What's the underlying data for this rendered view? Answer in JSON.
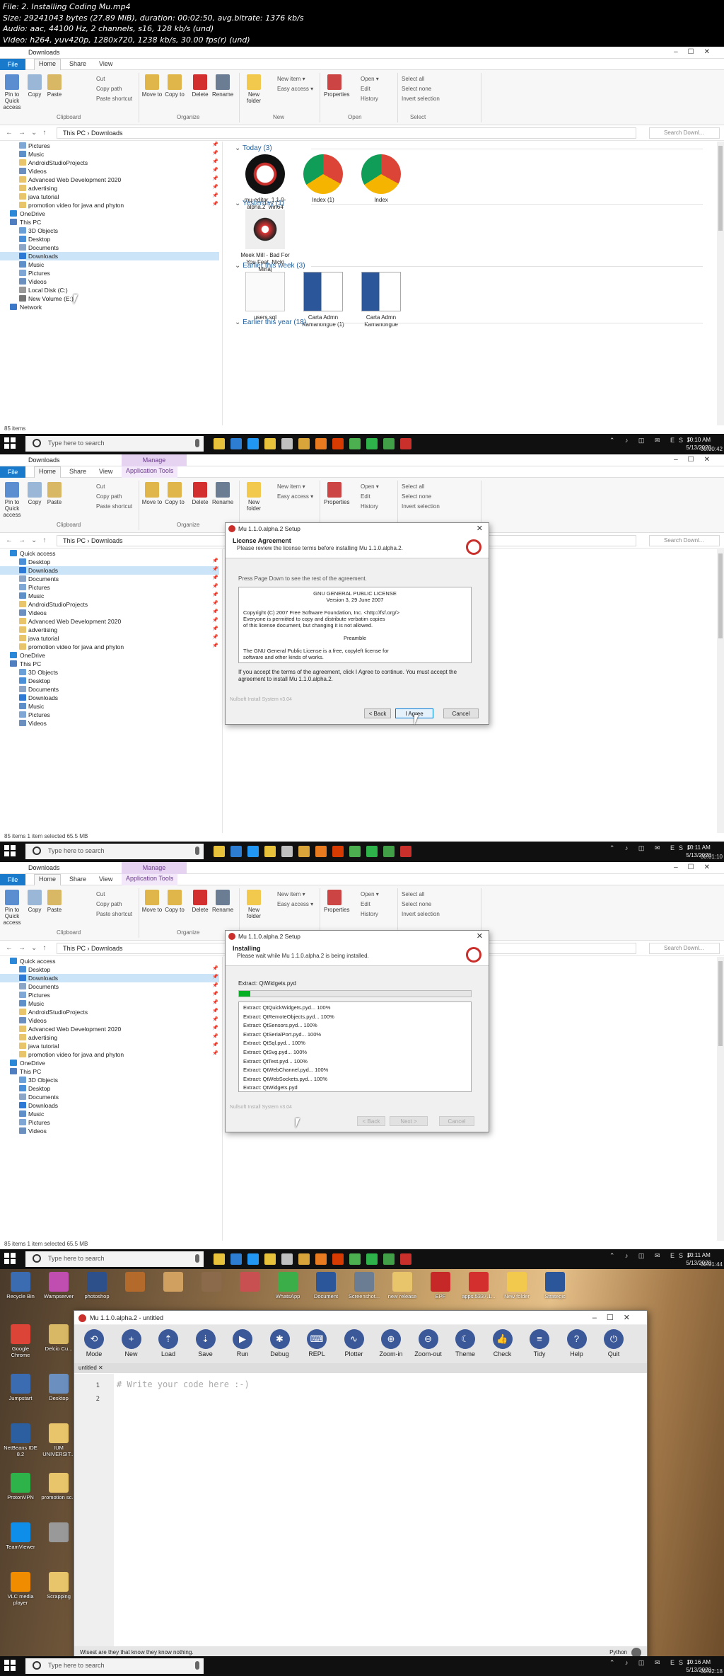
{
  "meta": {
    "line1": "File: 2. Installing Coding Mu.mp4",
    "line2": "Size: 29241043 bytes (27.89 MiB), duration: 00:02:50, avg.bitrate: 1376 kb/s",
    "line3": "Audio: aac, 44100 Hz, 2 channels, s16, 128 kb/s (und)",
    "line4": "Video: h264, yuv420p, 1280x720, 1238 kb/s, 30.00 fps(r) (und)"
  },
  "explorer": {
    "title": "Downloads",
    "manage": "Manage",
    "tabs": {
      "file": "File",
      "home": "Home",
      "share": "Share",
      "view": "View",
      "app_tools": "Application Tools"
    },
    "ribbon": {
      "pin": "Pin to Quick access",
      "copy": "Copy",
      "paste": "Paste",
      "cut": "Cut",
      "copy_path": "Copy path",
      "paste_shortcut": "Paste shortcut",
      "move_to": "Move to",
      "copy_to": "Copy to",
      "delete": "Delete",
      "rename": "Rename",
      "new_folder": "New folder",
      "new_item": "New item ▾",
      "easy_access": "Easy access ▾",
      "properties": "Properties",
      "open": "Open ▾",
      "edit": "Edit",
      "history": "History",
      "select_all": "Select all",
      "select_none": "Select none",
      "invert": "Invert selection",
      "g_clipboard": "Clipboard",
      "g_organize": "Organize",
      "g_new": "New",
      "g_open": "Open",
      "g_select": "Select"
    },
    "path": "This PC  ›  Downloads",
    "search": "Search Downl...",
    "nav1": [
      "Pictures",
      "Music",
      "AndroidStudioProjects",
      "Videos",
      "Advanced Web Development 2020",
      "advertising",
      "java tutorial",
      "promotion video for java and phyton",
      "OneDrive",
      "This PC",
      "3D Objects",
      "Desktop",
      "Documents",
      "Downloads",
      "Music",
      "Pictures",
      "Videos",
      "Local Disk (C:)",
      "New Volume (E:)",
      "Network"
    ],
    "nav2": [
      "Quick access",
      "Desktop",
      "Downloads",
      "Documents",
      "Pictures",
      "Music",
      "AndroidStudioProjects",
      "Videos",
      "Advanced Web Development 2020",
      "advertising",
      "java tutorial",
      "promotion video for java and phyton",
      "OneDrive",
      "This PC",
      "3D Objects",
      "Desktop",
      "Documents",
      "Downloads",
      "Music",
      "Pictures",
      "Videos"
    ],
    "groups": {
      "today": "Today (3)",
      "yesterday": "Yesterday (1)",
      "earlier_week": "Earlier this week (3)",
      "earlier_year": "Earlier this year (18)"
    },
    "files_today": [
      "mu-editor_1.1.0-alpha.2_win64",
      "Index (1)",
      "Index"
    ],
    "files_yesterday": [
      "Meek Mill - Bad For You Feat. Nicki Minaj"
    ],
    "files_week": [
      "users.sql",
      "Carta Admn Kamanongue (1)",
      "Carta Admn Kamanongue"
    ],
    "status1": "85 items",
    "status2": "85 items    1 item selected  65.5 MB"
  },
  "taskbar": {
    "search": "Type here to search",
    "lang": "ESP",
    "clock1": {
      "time": "10:10 AM",
      "date": "5/13/2020"
    },
    "clock2": {
      "time": "10:11 AM",
      "date": "5/13/2020"
    },
    "clock3": {
      "time": "10:11 AM",
      "date": "5/13/2020"
    },
    "clock4": {
      "time": "10:16 AM",
      "date": "5/13/2020"
    },
    "stamps": [
      "00:00:42",
      "00:01:10",
      "00:01:44",
      "00:02:18"
    ]
  },
  "license_dialog": {
    "title": "Mu 1.1.0.alpha.2 Setup",
    "heading": "License Agreement",
    "sub": "Please review the license terms before installing Mu 1.1.0.alpha.2.",
    "hint": "Press Page Down to see the rest of the agreement.",
    "text": [
      "GNU GENERAL PUBLIC LICENSE",
      "Version 3, 29 June 2007",
      "",
      "Copyright (C) 2007 Free Software Foundation, Inc. <http://fsf.org/>",
      "Everyone is permitted to copy and distribute verbatim copies",
      "of this license document, but changing it is not allowed.",
      "",
      "Preamble",
      "",
      "The GNU General Public License is a free, copyleft license for",
      "software and other kinds of works."
    ],
    "accept": "If you accept the terms of the agreement, click I Agree to continue. You must accept the agreement to install Mu 1.1.0.alpha.2.",
    "nsis": "Nullsoft Install System v3.04",
    "back": "< Back",
    "agree": "I Agree",
    "cancel": "Cancel"
  },
  "install_dialog": {
    "title": "Mu 1.1.0.alpha.2 Setup",
    "heading": "Installing",
    "sub": "Please wait while Mu 1.1.0.alpha.2 is being installed.",
    "current": "Extract: QtWidgets.pyd",
    "progress": 0.05,
    "log": [
      "Extract: QtQuickWidgets.pyd... 100%",
      "Extract: QtRemoteObjects.pyd... 100%",
      "Extract: QtSensors.pyd... 100%",
      "Extract: QtSerialPort.pyd... 100%",
      "Extract: QtSql.pyd... 100%",
      "Extract: QtSvg.pyd... 100%",
      "Extract: QtTest.pyd... 100%",
      "Extract: QtWebChannel.pyd... 100%",
      "Extract: QtWebSockets.pyd... 100%",
      "Extract: QtWidgets.pyd"
    ],
    "nsis": "Nullsoft Install System v3.04",
    "back": "< Back",
    "next": "Next >",
    "cancel": "Cancel"
  },
  "desktop": {
    "top_icons": [
      "Recycle Bin",
      "Wampserver",
      "photoshop",
      "",
      "",
      "",
      "",
      "WhatsApp",
      "Document",
      "Screenshot...",
      "new release",
      "EPF",
      "apps.5337.1...",
      "New folder",
      "Strategic"
    ],
    "left_icons": [
      "Google Chrome",
      "Delcio Cu...",
      "Jumpstart",
      "Desktop",
      "NetBeans IDE 8.2",
      "IUM UNIVERSIT...",
      "ProtonVPN",
      "promotion sc...",
      "TeamViewer",
      "",
      "VLC media player",
      "Scrapping"
    ]
  },
  "mu": {
    "title": "Mu 1.1.0.alpha.2 - untitled",
    "tools": [
      {
        "label": "Mode",
        "glyph": "⟲"
      },
      {
        "label": "New",
        "glyph": "+"
      },
      {
        "label": "Load",
        "glyph": "⇡"
      },
      {
        "label": "Save",
        "glyph": "⇣"
      },
      {
        "label": "Run",
        "glyph": "▶"
      },
      {
        "label": "Debug",
        "glyph": "✱"
      },
      {
        "label": "REPL",
        "glyph": "⌨"
      },
      {
        "label": "Plotter",
        "glyph": "∿"
      },
      {
        "label": "Zoom-in",
        "glyph": "⊕"
      },
      {
        "label": "Zoom-out",
        "glyph": "⊖"
      },
      {
        "label": "Theme",
        "glyph": "☾"
      },
      {
        "label": "Check",
        "glyph": "👍"
      },
      {
        "label": "Tidy",
        "glyph": "≡"
      },
      {
        "label": "Help",
        "glyph": "?"
      },
      {
        "label": "Quit",
        "glyph": "⏻"
      }
    ],
    "tab": "untitled ✕",
    "lines": [
      "1",
      "2"
    ],
    "placeholder": "# Write your code here :-)",
    "status": "Wisest are they that know they know nothing.",
    "mode": "Python"
  }
}
